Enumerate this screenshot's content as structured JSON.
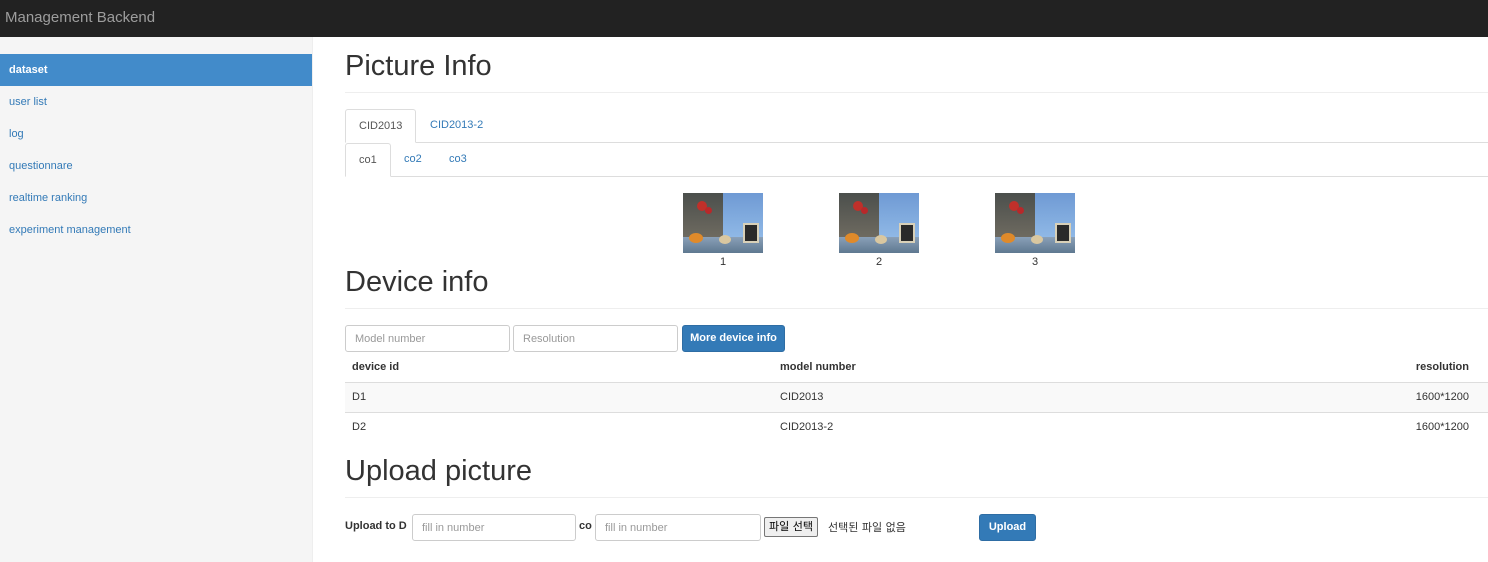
{
  "navbar": {
    "brand": "Management Backend"
  },
  "sidebar": {
    "items": [
      {
        "label": "dataset",
        "active": true
      },
      {
        "label": "user list"
      },
      {
        "label": "log"
      },
      {
        "label": "questionnare"
      },
      {
        "label": "realtime ranking"
      },
      {
        "label": "experiment management"
      }
    ]
  },
  "picture_info": {
    "title": "Picture Info",
    "dataset_tabs": [
      {
        "label": "CID2013",
        "active": true
      },
      {
        "label": "CID2013-2"
      }
    ],
    "co_tabs": [
      {
        "label": "co1",
        "active": true
      },
      {
        "label": "co2"
      },
      {
        "label": "co3"
      }
    ],
    "pictures": [
      {
        "caption": "1"
      },
      {
        "caption": "2"
      },
      {
        "caption": "3"
      }
    ]
  },
  "device_info": {
    "title": "Device info",
    "model_placeholder": "Model number",
    "resolution_placeholder": "Resolution",
    "more_button": "More device info",
    "columns": [
      "device id",
      "model number",
      "resolution"
    ],
    "rows": [
      {
        "device_id": "D1",
        "model_number": "CID2013",
        "resolution": "1600*1200"
      },
      {
        "device_id": "D2",
        "model_number": "CID2013-2",
        "resolution": "1600*1200"
      }
    ]
  },
  "upload": {
    "title": "Upload picture",
    "upload_to_label": "Upload to D",
    "co_label": "co",
    "number_placeholder": "fill in number",
    "file_button": "파일 선택",
    "no_file_text": "선택된 파일 없음",
    "upload_button": "Upload"
  }
}
